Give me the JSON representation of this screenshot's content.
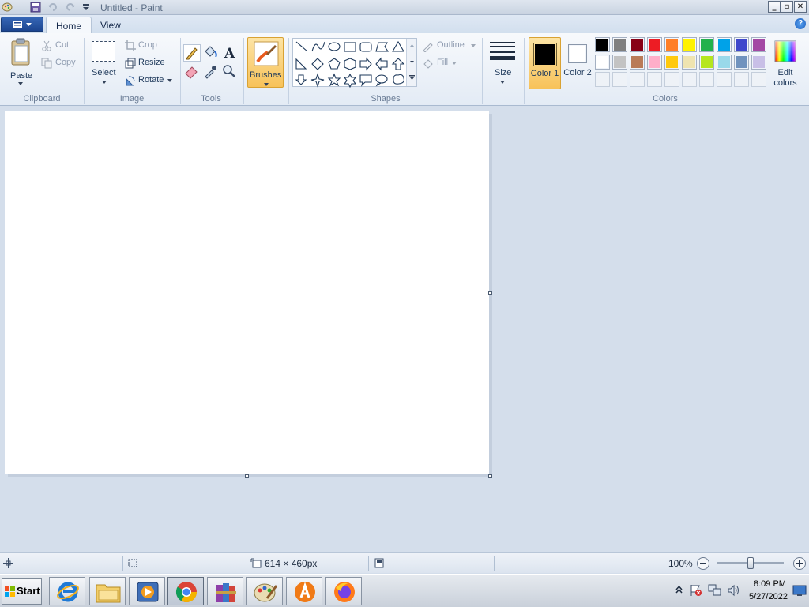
{
  "window": {
    "title": "Untitled - Paint"
  },
  "tabs": [
    {
      "label": "Home",
      "active": true
    },
    {
      "label": "View",
      "active": false
    }
  ],
  "clipboard": {
    "paste": "Paste",
    "cut": "Cut",
    "copy": "Copy",
    "group": "Clipboard"
  },
  "image": {
    "select": "Select",
    "crop": "Crop",
    "resize": "Resize",
    "rotate": "Rotate",
    "group": "Image"
  },
  "tools": {
    "group": "Tools"
  },
  "brushes": {
    "label": "Brushes"
  },
  "shapes": {
    "outline": "Outline",
    "fill": "Fill",
    "group": "Shapes"
  },
  "size": {
    "label": "Size"
  },
  "colors": {
    "color1": "Color 1",
    "color2": "Color 2",
    "color1_value": "#000000",
    "color2_value": "#ffffff",
    "edit": "Edit colors",
    "group": "Colors",
    "palette_row1": [
      "#000000",
      "#7f7f7f",
      "#880015",
      "#ed1c24",
      "#ff7f27",
      "#fff200",
      "#22b14c",
      "#00a2e8",
      "#3f48cc",
      "#a349a4"
    ],
    "palette_row2": [
      "#ffffff",
      "#c3c3c3",
      "#b97a57",
      "#ffaec9",
      "#ffc90e",
      "#efe4b0",
      "#b5e61d",
      "#99d9ea",
      "#7092be",
      "#c8bfe7"
    ],
    "palette_row3": [
      "",
      "",
      "",
      "",
      "",
      "",
      "",
      "",
      "",
      ""
    ]
  },
  "status": {
    "dimensions": "614 × 460px",
    "zoom": "100%"
  },
  "taskbar": {
    "start": "Start",
    "time": "8:09 PM",
    "date": "5/27/2022"
  }
}
